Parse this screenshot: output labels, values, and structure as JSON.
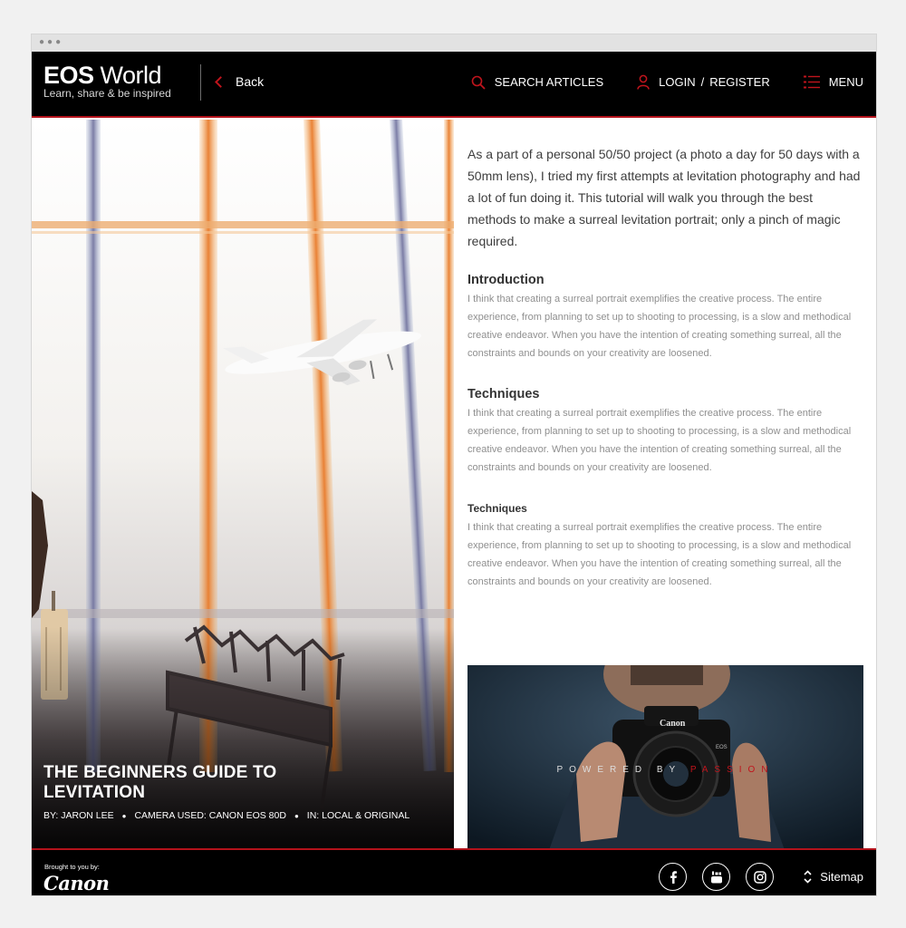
{
  "header": {
    "logo_title_bold": "EOS",
    "logo_title_light": "World",
    "logo_tagline": "Learn, share & be inspired",
    "back_label": "Back",
    "search_label": "SEARCH ARTICLES",
    "login_label": "LOGIN",
    "slash": "/",
    "register_label": "REGISTER",
    "menu_label": "MENU"
  },
  "hero": {
    "title": "THE BEGINNERS GUIDE TO LEVITATION",
    "author": "BY: JARON LEE",
    "camera": "CAMERA USED: CANON EOS 80D",
    "category": "IN: LOCAL & ORIGINAL",
    "separator": "●"
  },
  "article": {
    "intro": "As a part of a personal 50/50 project (a photo a day for 50 days with a 50mm lens), I tried my first attempts at levitation photography and had a lot of fun doing it. This tutorial will walk you through the best methods to make a surreal levitation portrait; only a pinch of magic required.",
    "sections": [
      {
        "heading": "Introduction",
        "body": "I think that creating a surreal portrait exemplifies the creative process. The entire experience, from planning to set up to shooting to processing, is a slow and methodical creative endeavor. When you have the intention of creating something surreal, all the constraints and bounds on your creativity are loosened."
      },
      {
        "heading": "Techniques",
        "body": "I think that creating a surreal portrait exemplifies the creative process. The entire experience, from planning to set up to shooting to processing, is a slow and methodical creative endeavor. When you have the intention of creating something surreal, all the constraints and bounds on your creativity are loosened."
      },
      {
        "heading": "Techniques",
        "body": "I think that creating a surreal portrait exemplifies the creative process. The entire experience, from planning to set up to shooting to processing, is a slow and methodical creative endeavor. When you have the intention of creating something surreal, all the constraints and bounds on your creativity are loosened."
      }
    ],
    "photo": {
      "camera_brand": "Canon",
      "model_badge": "EOS",
      "tagline_white": "POWERED BY ",
      "tagline_red": "PASSION"
    }
  },
  "footer": {
    "brought_label": "Brought to you by:",
    "brand": "Canon",
    "social_icons": [
      "facebook-icon",
      "youtube-icon",
      "instagram-icon"
    ],
    "sitemap_label": "Sitemap"
  },
  "colors": {
    "accent_red": "#c0141c",
    "nav_bg": "#000000"
  }
}
